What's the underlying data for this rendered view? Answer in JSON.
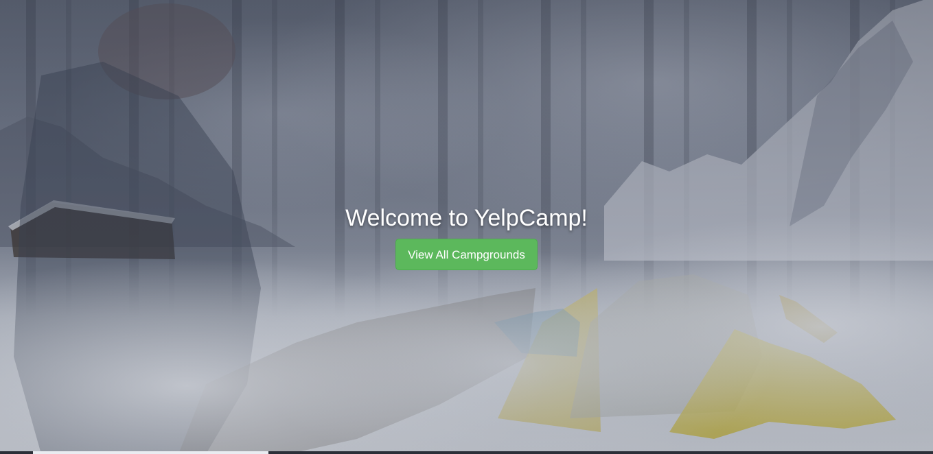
{
  "hero": {
    "title": "Welcome to YelpCamp!",
    "button_label": "View All Campgrounds"
  },
  "colors": {
    "button_bg": "#5cb85c",
    "button_border": "#4cae4c",
    "title_text": "#ffffff"
  },
  "background": {
    "slides": [
      "woman-in-beanie-photo",
      "snowy-forest-photo",
      "snowy-mountains-photo",
      "yellow-tents-photo"
    ]
  }
}
